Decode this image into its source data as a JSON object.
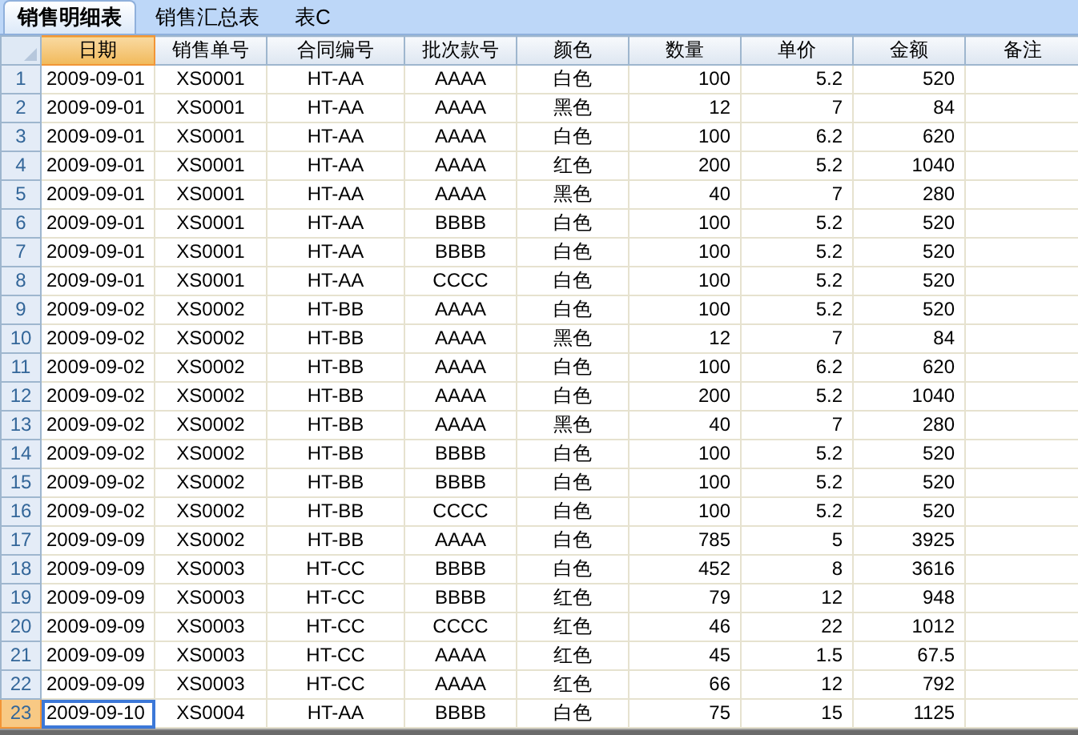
{
  "tabs": [
    {
      "label": "销售明细表",
      "selected": true
    },
    {
      "label": "销售汇总表",
      "selected": false
    },
    {
      "label": "表C",
      "selected": false
    }
  ],
  "columns": [
    {
      "label": "日期",
      "selected": true
    },
    {
      "label": "销售单号",
      "selected": false
    },
    {
      "label": "合同编号",
      "selected": false
    },
    {
      "label": "批次款号",
      "selected": false
    },
    {
      "label": "颜色",
      "selected": false
    },
    {
      "label": "数量",
      "selected": false
    },
    {
      "label": "单价",
      "selected": false
    },
    {
      "label": "金额",
      "selected": false
    },
    {
      "label": "备注",
      "selected": false
    }
  ],
  "rows": [
    {
      "number": "1",
      "selected": false,
      "cells": [
        "2009-09-01",
        "XS0001",
        "HT-AA",
        "AAAA",
        "白色",
        "100",
        "5.2",
        "520"
      ]
    },
    {
      "number": "2",
      "selected": false,
      "cells": [
        "2009-09-01",
        "XS0001",
        "HT-AA",
        "AAAA",
        "黑色",
        "12",
        "7",
        "84"
      ]
    },
    {
      "number": "3",
      "selected": false,
      "cells": [
        "2009-09-01",
        "XS0001",
        "HT-AA",
        "AAAA",
        "白色",
        "100",
        "6.2",
        "620"
      ]
    },
    {
      "number": "4",
      "selected": false,
      "cells": [
        "2009-09-01",
        "XS0001",
        "HT-AA",
        "AAAA",
        "红色",
        "200",
        "5.2",
        "1040"
      ]
    },
    {
      "number": "5",
      "selected": false,
      "cells": [
        "2009-09-01",
        "XS0001",
        "HT-AA",
        "AAAA",
        "黑色",
        "40",
        "7",
        "280"
      ]
    },
    {
      "number": "6",
      "selected": false,
      "cells": [
        "2009-09-01",
        "XS0001",
        "HT-AA",
        "BBBB",
        "白色",
        "100",
        "5.2",
        "520"
      ]
    },
    {
      "number": "7",
      "selected": false,
      "cells": [
        "2009-09-01",
        "XS0001",
        "HT-AA",
        "BBBB",
        "白色",
        "100",
        "5.2",
        "520"
      ]
    },
    {
      "number": "8",
      "selected": false,
      "cells": [
        "2009-09-01",
        "XS0001",
        "HT-AA",
        "CCCC",
        "白色",
        "100",
        "5.2",
        "520"
      ]
    },
    {
      "number": "9",
      "selected": false,
      "cells": [
        "2009-09-02",
        "XS0002",
        "HT-BB",
        "AAAA",
        "白色",
        "100",
        "5.2",
        "520"
      ]
    },
    {
      "number": "10",
      "selected": false,
      "cells": [
        "2009-09-02",
        "XS0002",
        "HT-BB",
        "AAAA",
        "黑色",
        "12",
        "7",
        "84"
      ]
    },
    {
      "number": "11",
      "selected": false,
      "cells": [
        "2009-09-02",
        "XS0002",
        "HT-BB",
        "AAAA",
        "白色",
        "100",
        "6.2",
        "620"
      ]
    },
    {
      "number": "12",
      "selected": false,
      "cells": [
        "2009-09-02",
        "XS0002",
        "HT-BB",
        "AAAA",
        "白色",
        "200",
        "5.2",
        "1040"
      ]
    },
    {
      "number": "13",
      "selected": false,
      "cells": [
        "2009-09-02",
        "XS0002",
        "HT-BB",
        "AAAA",
        "黑色",
        "40",
        "7",
        "280"
      ]
    },
    {
      "number": "14",
      "selected": false,
      "cells": [
        "2009-09-02",
        "XS0002",
        "HT-BB",
        "BBBB",
        "白色",
        "100",
        "5.2",
        "520"
      ]
    },
    {
      "number": "15",
      "selected": false,
      "cells": [
        "2009-09-02",
        "XS0002",
        "HT-BB",
        "BBBB",
        "白色",
        "100",
        "5.2",
        "520"
      ]
    },
    {
      "number": "16",
      "selected": false,
      "cells": [
        "2009-09-02",
        "XS0002",
        "HT-BB",
        "CCCC",
        "白色",
        "100",
        "5.2",
        "520"
      ]
    },
    {
      "number": "17",
      "selected": false,
      "cells": [
        "2009-09-09",
        "XS0002",
        "HT-BB",
        "AAAA",
        "白色",
        "785",
        "5",
        "3925"
      ]
    },
    {
      "number": "18",
      "selected": false,
      "cells": [
        "2009-09-09",
        "XS0003",
        "HT-CC",
        "BBBB",
        "白色",
        "452",
        "8",
        "3616"
      ]
    },
    {
      "number": "19",
      "selected": false,
      "cells": [
        "2009-09-09",
        "XS0003",
        "HT-CC",
        "BBBB",
        "红色",
        "79",
        "12",
        "948"
      ]
    },
    {
      "number": "20",
      "selected": false,
      "cells": [
        "2009-09-09",
        "XS0003",
        "HT-CC",
        "CCCC",
        "红色",
        "46",
        "22",
        "1012"
      ]
    },
    {
      "number": "21",
      "selected": false,
      "cells": [
        "2009-09-09",
        "XS0003",
        "HT-CC",
        "AAAA",
        "红色",
        "45",
        "1.5",
        "67.5"
      ]
    },
    {
      "number": "22",
      "selected": false,
      "cells": [
        "2009-09-09",
        "XS0003",
        "HT-CC",
        "AAAA",
        "红色",
        "66",
        "12",
        "792"
      ]
    },
    {
      "number": "23",
      "selected": true,
      "cells": [
        "2009-09-10",
        "XS0004",
        "HT-AA",
        "BBBB",
        "白色",
        "75",
        "15",
        "1125"
      ]
    }
  ]
}
